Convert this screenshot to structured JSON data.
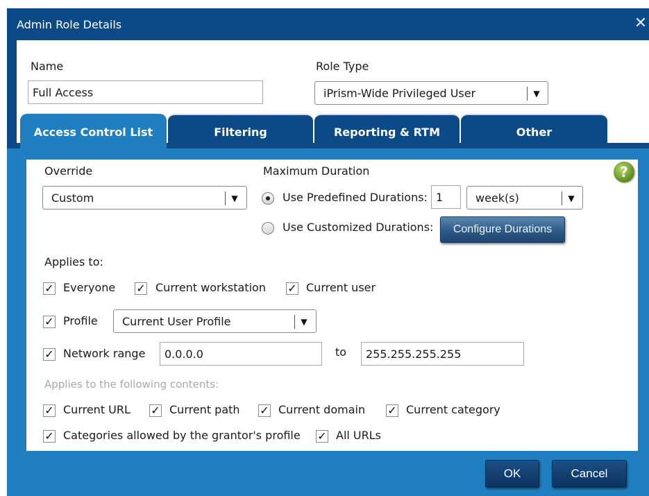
{
  "window": {
    "title": "Admin Role Details",
    "close_glyph": "✕"
  },
  "name_field": {
    "label": "Name",
    "value": "Full Access"
  },
  "role_type": {
    "label": "Role Type",
    "value": "iPrism-Wide Privileged User"
  },
  "tabs": [
    {
      "label": "Access Control List",
      "active": true
    },
    {
      "label": "Filtering",
      "active": false
    },
    {
      "label": "Reporting & RTM",
      "active": false
    },
    {
      "label": "Other",
      "active": false
    }
  ],
  "override": {
    "label": "Override",
    "value": "Custom"
  },
  "max_duration": {
    "label": "Maximum Duration",
    "predefined_label": "Use Predefined Durations:",
    "predefined_selected": true,
    "predefined_count": "1",
    "predefined_unit": "week(s)",
    "customized_label": "Use Customized Durations:",
    "configure_button": "Configure Durations"
  },
  "help_glyph": "?",
  "applies_to": {
    "label": "Applies to:",
    "everyone": {
      "label": "Everyone",
      "checked": true
    },
    "current_workstation": {
      "label": "Current workstation",
      "checked": true
    },
    "current_user": {
      "label": "Current user",
      "checked": true
    },
    "profile": {
      "label": "Profile",
      "checked": true,
      "value": "Current User Profile"
    },
    "network_range": {
      "label": "Network range",
      "checked": true,
      "from": "0.0.0.0",
      "to_label": "to",
      "to": "255.255.255.255"
    }
  },
  "contents": {
    "label": "Applies to the following contents:",
    "current_url": {
      "label": "Current URL",
      "checked": true
    },
    "current_path": {
      "label": "Current path",
      "checked": true
    },
    "current_domain": {
      "label": "Current domain",
      "checked": true
    },
    "current_category": {
      "label": "Current category",
      "checked": true
    },
    "categories_allowed": {
      "label": "Categories allowed by the grantor's profile",
      "checked": true
    },
    "all_urls": {
      "label": "All URLs",
      "checked": true
    }
  },
  "buttons": {
    "ok": "OK",
    "cancel": "Cancel"
  },
  "check_glyph": "✓",
  "dropdown_glyph": "▼",
  "colors": {
    "title_bar": "#0b4a86",
    "active_tab": "#1f7fc0",
    "help_icon": "#5c8a1a"
  }
}
